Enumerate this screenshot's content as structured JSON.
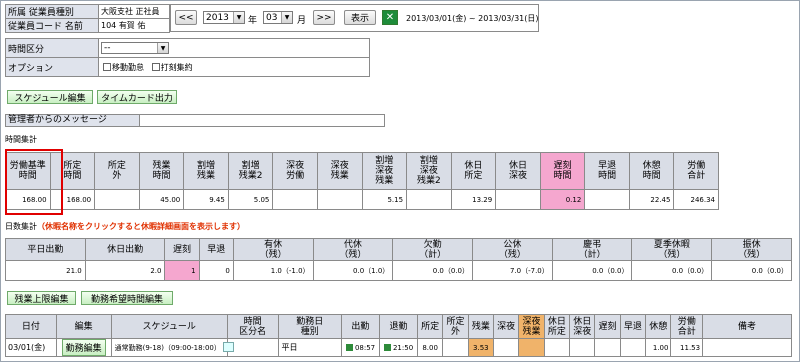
{
  "info": {
    "affiliation_label": "所属",
    "type_label": "従業員種別",
    "affiliation_value": "大阪支社 正社員",
    "code_label": "従業員コード",
    "name_label": "名前",
    "code_name_value": "104 有賀 佑",
    "time_label": "時間区分",
    "time_value": "--",
    "option_label": "オプション",
    "option_move": "移動勤怠",
    "option_stamp": "打刻集約"
  },
  "nav": {
    "prev": "<<",
    "year": "2013",
    "year_unit": "年",
    "month": "03",
    "month_unit": "月",
    "next": ">>",
    "show": "表示",
    "range": "2013/03/01(金) ~ 2013/03/31(日)",
    "excel_icon": "excel-icon"
  },
  "actions": {
    "schedule_edit": "スケジュール編集",
    "timecard_output": "タイムカード出力"
  },
  "message": {
    "label": "管理者からのメッセージ"
  },
  "time_summary": {
    "title": "時間集計",
    "headers": [
      "労働基準\n時間",
      "所定\n時間",
      "所定\n外",
      "残業\n時間",
      "割増\n残業",
      "割増\n残業2",
      "深夜\n労働",
      "深夜\n残業",
      "割増\n深夜\n残業",
      "割増\n深夜\n残業2",
      "休日\n所定",
      "休日\n深夜",
      "遅刻\n時間",
      "早退\n時間",
      "休憩\n時間",
      "労働\n合計"
    ],
    "values": [
      "168.00",
      "168.00",
      "",
      "45.00",
      "9.45",
      "5.05",
      "",
      "",
      "5.15",
      "",
      "13.29",
      "",
      "0.12",
      "",
      "22.45",
      "246.34"
    ],
    "highlight_color": "#f5a7cf",
    "box_color": "#e00000"
  },
  "day_summary": {
    "title": "日数集計",
    "note": "（休暇名称をクリックすると休暇詳細画面を表示します）",
    "note_color": "#e03000",
    "headers": [
      "平日出勤",
      "休日出勤",
      "遅刻",
      "早退",
      "有休\n（残）",
      "代休\n（残）",
      "欠勤\n（計）",
      "公休\n（残）",
      "慶弔\n（計）",
      "夏季休暇\n（残）",
      "振休\n（残）"
    ],
    "values": [
      "21.0",
      "2.0",
      "1",
      "0",
      "1.0（-1.0）",
      "0.0（1.0）",
      "0.0（0.0）",
      "7.0（-7.0）",
      "0.0（0.0）",
      "0.0（0.0）",
      "0.0（0.0）"
    ]
  },
  "actions2": {
    "overtime_limit": "残業上限編集",
    "hope_time": "勤務希望時間編集"
  },
  "detail": {
    "headers": [
      "日付",
      "編集",
      "スケジュール",
      "時間\n区分名",
      "勤務日\n種別",
      "出勤",
      "退勤",
      "所定",
      "所定\n外",
      "残業",
      "深夜",
      "深夜\n残業",
      "休日\n所定",
      "休日\n深夜",
      "遅刻",
      "早退",
      "休憩",
      "労働\n合計",
      "備考"
    ],
    "row": {
      "date": "03/01(金)",
      "edit": "勤務編集",
      "schedule": "通常勤務(9-18)（09:00-18:00）",
      "day_type": "平日",
      "in_icon": "stamp-icon",
      "in_time": "08:57",
      "out_time": "21:50",
      "scheduled": "8.00",
      "overtime": "3.53",
      "rest": "1.00",
      "total": "11.53"
    }
  }
}
